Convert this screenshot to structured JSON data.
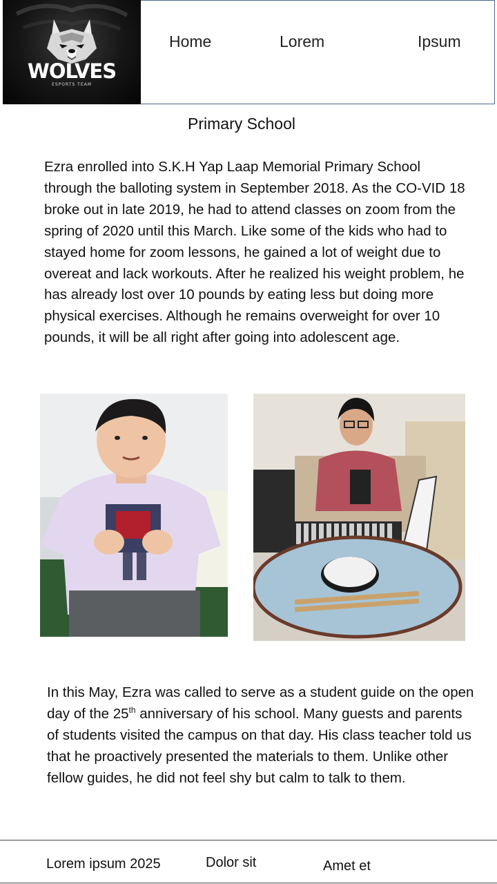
{
  "header": {
    "logo": {
      "brand": "WOLVES",
      "tagline": "ESPORTS TEAM"
    },
    "nav": [
      {
        "label": "Home"
      },
      {
        "label": "Lorem"
      },
      {
        "label": "Ipsum"
      }
    ]
  },
  "main": {
    "title": "Primary School",
    "paragraph1": "Ezra enrolled into S.K.H Yap Laap Memorial Primary School through the balloting system in September 2018.  As the CO-VID 18 broke out in late 2019, he had to attend classes on zoom from the spring of 2020 until this March.   Like some of the kids who had to stayed home for zoom lessons, he gained a lot of weight due to overeat and lack workouts.  After he realized his weight problem, he has already lost over 10 pounds by eating less but doing more physical exercises.  Although he remains overweight for over 10 pounds, it will be all right after going into adolescent age.",
    "paragraph2": {
      "before": "In this May, Ezra was called to serve as a student guide on the open day of the 25",
      "sup": "th",
      "after": " anniversary of his school.  Many guests and parents of students visited the campus on that day.  His class teacher told us that he proactively presented the materials to them.  Unlike other fellow guides, he did not feel shy but calm to talk to them."
    }
  },
  "footer": {
    "items": [
      {
        "label": "Lorem ipsum 2025"
      },
      {
        "label": "Dolor sit"
      },
      {
        "label": "Amet et"
      }
    ]
  }
}
